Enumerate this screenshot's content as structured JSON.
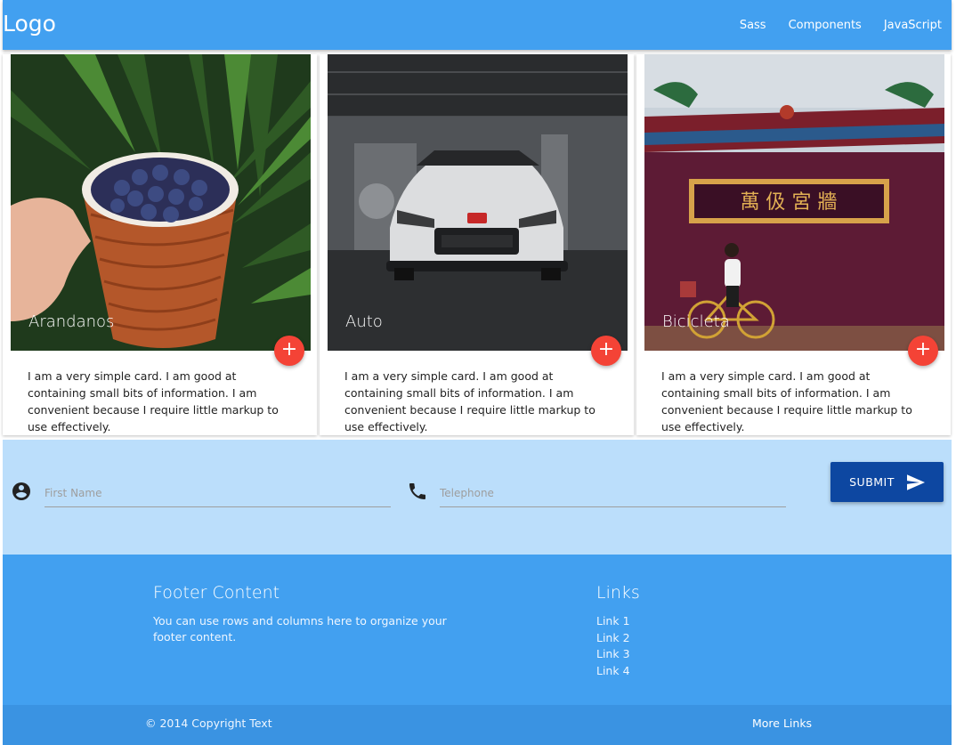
{
  "navbar": {
    "logo": "Logo",
    "links": [
      "Sass",
      "Components",
      "JavaScript"
    ]
  },
  "cards": [
    {
      "title": "Arandanos",
      "text": "I am a very simple card. I am good at containing small bits of information. I am convenient because I require little markup to use effectively.",
      "fab": "+"
    },
    {
      "title": "Auto",
      "text": "I am a very simple card. I am good at containing small bits of information. I am convenient because I require little markup to use effectively.",
      "fab": "+"
    },
    {
      "title": "Bicicleta",
      "text": "I am a very simple card. I am good at containing small bits of information. I am convenient because I require little markup to use effectively.",
      "fab": "+"
    }
  ],
  "sign_text": "萬 伋 宮 牆",
  "form": {
    "first_name_placeholder": "First Name",
    "telephone_placeholder": "Telephone",
    "submit_label": "SUBMIT"
  },
  "footer": {
    "title": "Footer Content",
    "text": "You can use rows and columns here to organize your footer content.",
    "links_title": "Links",
    "links": [
      "Link 1",
      "Link 2",
      "Link 3",
      "Link 4"
    ],
    "copyright": "© 2014 Copyright Text",
    "more_links": "More Links"
  },
  "colors": {
    "primary": "#42a0f0",
    "fab": "#f44336",
    "form_bg": "#bbdefb",
    "submit": "#0d47a1"
  }
}
